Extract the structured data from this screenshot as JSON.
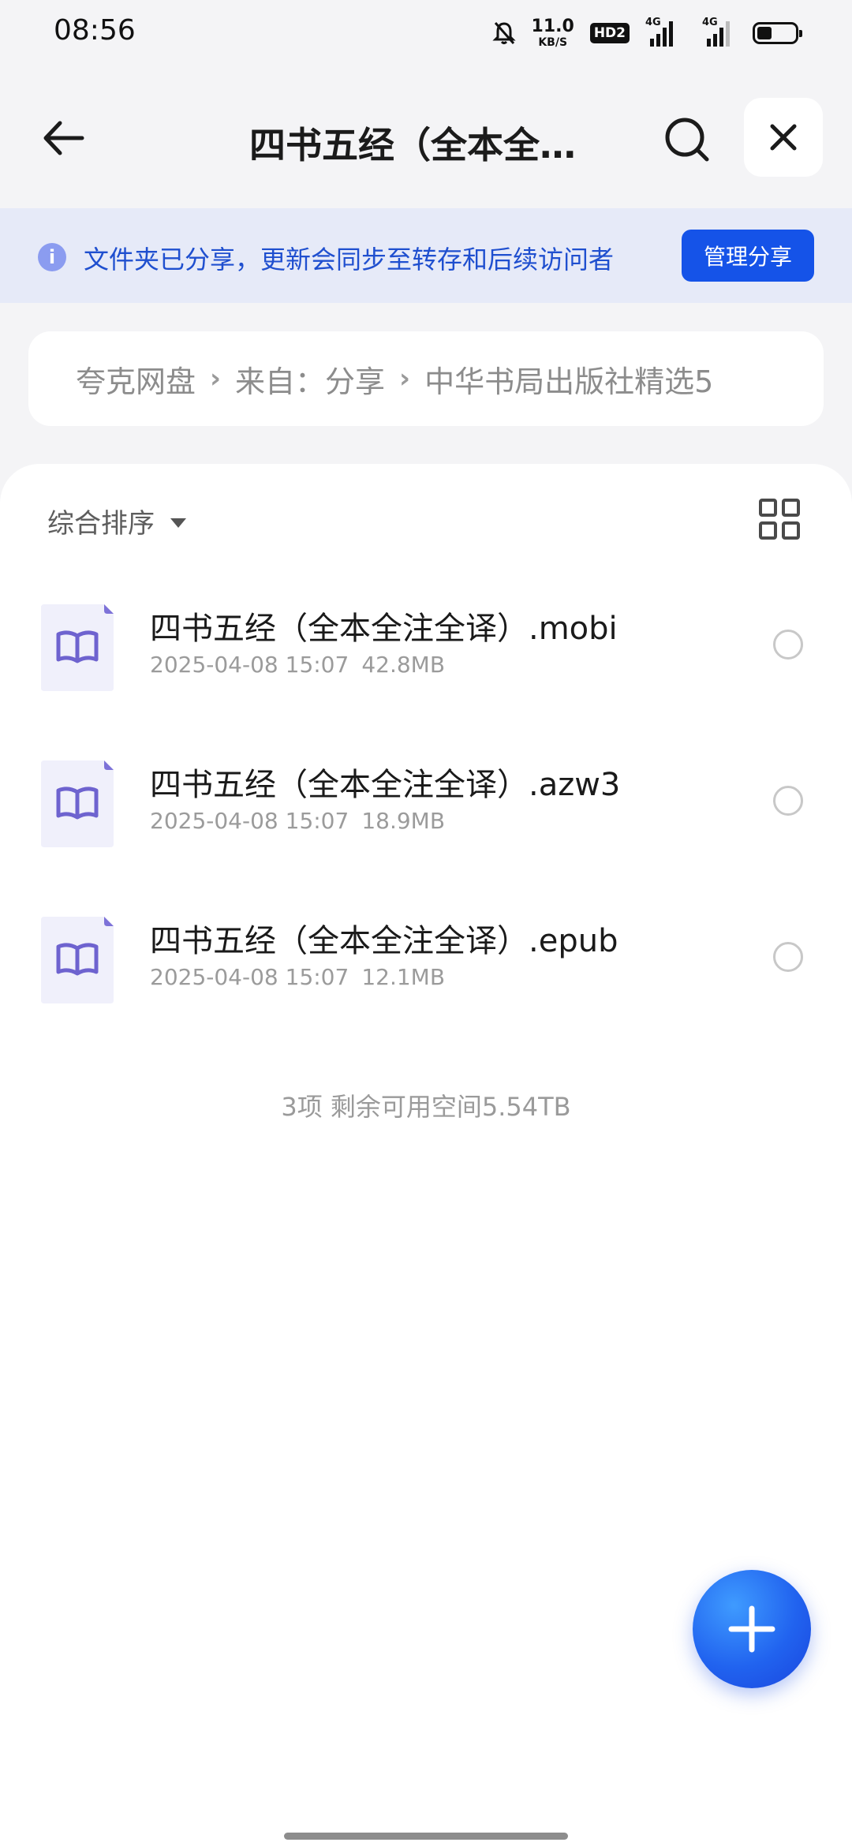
{
  "status_bar": {
    "time": "08:56",
    "net_speed_value": "11.0",
    "net_speed_unit": "KB/S",
    "hd_label": "HD2",
    "signal_1_label": "4G",
    "signal_2_label": "4G",
    "battery_level": 0.4,
    "icons": [
      "mute-bell-icon",
      "hd-voice-icon",
      "signal-icon",
      "battery-icon"
    ]
  },
  "header": {
    "title": "四书五经（全本全…",
    "icons": [
      "back-arrow-icon",
      "search-icon",
      "close-icon"
    ]
  },
  "share_banner": {
    "icon": "info-icon",
    "text": "文件夹已分享，更新会同步至转存和后续访问者",
    "button_label": "管理分享",
    "text_color": "#1f4fcf",
    "button_color": "#1553e8"
  },
  "breadcrumb": {
    "items": [
      "夸克网盘",
      "来自：分享",
      "中华书局出版社精选5"
    ]
  },
  "toolbar": {
    "sort_label": "综合排序",
    "view_toggle_icon": "grid-view-icon"
  },
  "files": [
    {
      "name": "四书五经（全本全注全译）.mobi",
      "date": "2025-04-08 15:07",
      "size": "42.8MB",
      "icon": "ebook-file-icon"
    },
    {
      "name": "四书五经（全本全注全译）.azw3",
      "date": "2025-04-08 15:07",
      "size": "18.9MB",
      "icon": "ebook-file-icon"
    },
    {
      "name": "四书五经（全本全注全译）.epub",
      "date": "2025-04-08 15:07",
      "size": "12.1MB",
      "icon": "ebook-file-icon"
    }
  ],
  "summary": "3项 剩余可用空间5.54TB",
  "fab": {
    "icon": "plus-icon",
    "color": "#2163ef"
  }
}
